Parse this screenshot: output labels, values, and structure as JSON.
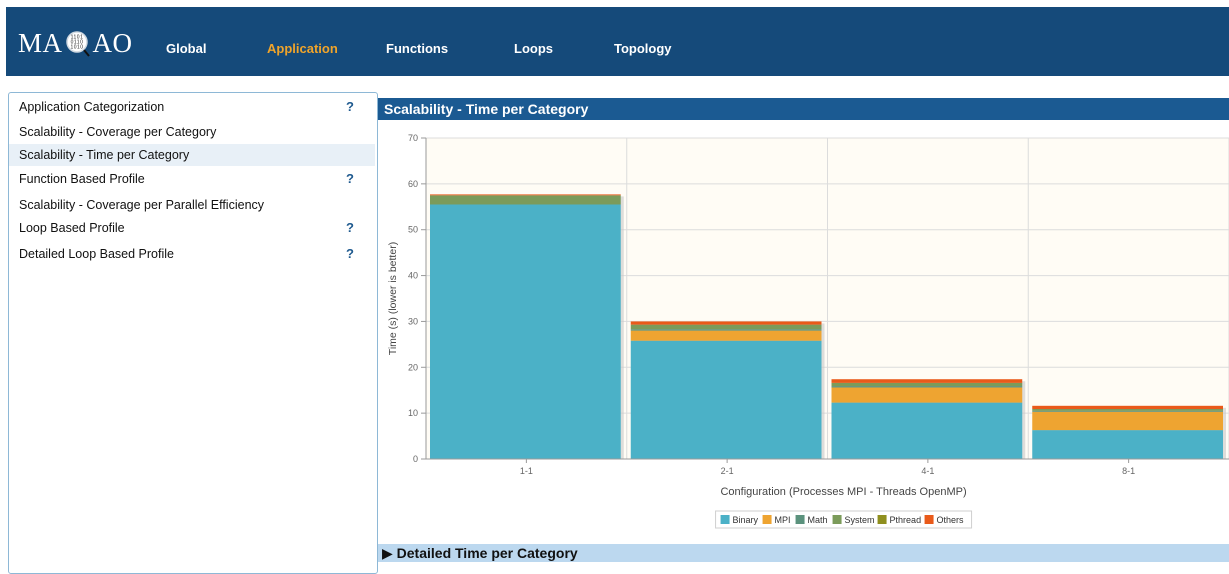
{
  "app": {
    "logo_left": "MA",
    "logo_right": "AO",
    "logo_icon": "magnifier-binary-icon"
  },
  "nav": {
    "items": [
      {
        "label": "Global",
        "active": false
      },
      {
        "label": "Application",
        "active": true
      },
      {
        "label": "Functions",
        "active": false
      },
      {
        "label": "Loops",
        "active": false
      },
      {
        "label": "Topology",
        "active": false
      }
    ],
    "active_color": "#f0a42a"
  },
  "sidebar": {
    "items": [
      {
        "label": "Application Categorization",
        "help": "?"
      },
      {
        "label": "Scalability - Coverage per Category",
        "help": ""
      },
      {
        "label": "Scalability - Time per Category",
        "help": "",
        "selected": true
      },
      {
        "label": "Function Based Profile",
        "help": "?"
      },
      {
        "label": "Scalability - Coverage per Parallel Efficiency",
        "help": ""
      },
      {
        "label": "Loop Based Profile",
        "help": "?"
      },
      {
        "label": "Detailed Loop Based Profile",
        "help": "?"
      }
    ]
  },
  "panel": {
    "title": "Scalability - Time per Category",
    "detail_label": "▶ Detailed Time per Category"
  },
  "chart_data": {
    "type": "bar",
    "stacked": true,
    "categories": [
      "1-1",
      "2-1",
      "4-1",
      "8-1"
    ],
    "series": [
      {
        "name": "Binary",
        "color": "#4bb1c7",
        "values": [
          55.5,
          25.8,
          12.3,
          6.3
        ]
      },
      {
        "name": "MPI",
        "color": "#eea431",
        "values": [
          0,
          2.2,
          3.3,
          4.0
        ]
      },
      {
        "name": "Math",
        "color": "#5b927d",
        "values": [
          0,
          0.3,
          0.3,
          0.2
        ]
      },
      {
        "name": "System",
        "color": "#7b9b5a",
        "values": [
          2.0,
          1.0,
          0.7,
          0.4
        ]
      },
      {
        "name": "Pthread",
        "color": "#8f8f1e",
        "values": [
          0,
          0,
          0,
          0
        ]
      },
      {
        "name": "Others",
        "color": "#e95a1a",
        "values": [
          0.2,
          0.7,
          0.8,
          0.7
        ]
      }
    ],
    "title": "",
    "xlabel": "Configuration (Processes MPI - Threads OpenMP)",
    "ylabel": "Time (s) (lower is better)",
    "ylim": [
      0,
      70
    ],
    "yticks": [
      0,
      10,
      20,
      30,
      40,
      50,
      60,
      70
    ],
    "grid": true,
    "legend_position": "bottom",
    "plot_background": "#fffcf5"
  }
}
